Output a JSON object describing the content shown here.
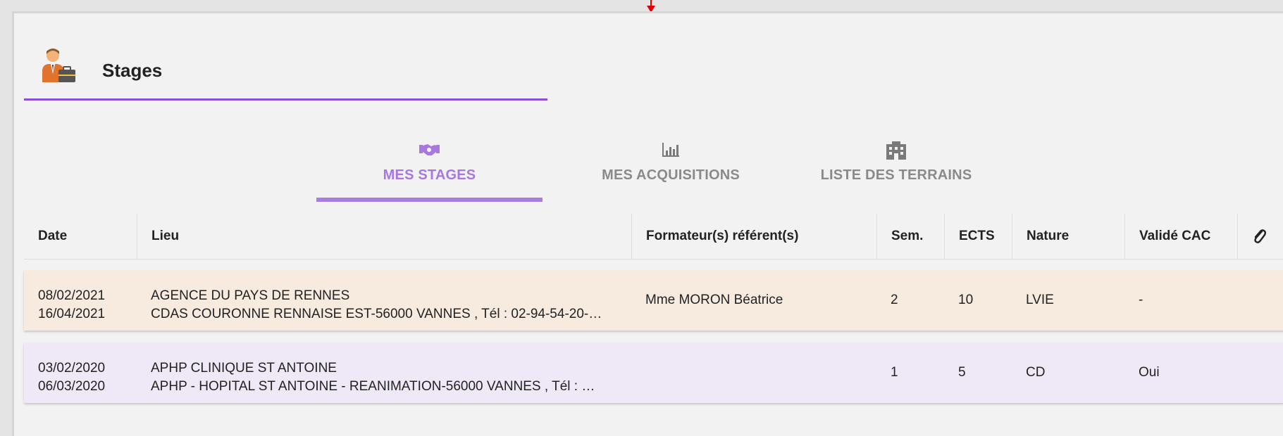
{
  "header": {
    "title": "Stages",
    "icon": "business-person-icon"
  },
  "tabs": [
    {
      "label": "MES STAGES",
      "icon": "handshake-icon",
      "active": true
    },
    {
      "label": "MES ACQUISITIONS",
      "icon": "bar-chart-icon",
      "active": false
    },
    {
      "label": "LISTE DES TERRAINS",
      "icon": "building-icon",
      "active": false
    }
  ],
  "table": {
    "headers": {
      "date": "Date",
      "lieu": "Lieu",
      "formateur": "Formateur(s) référent(s)",
      "sem": "Sem.",
      "ects": "ECTS",
      "nature": "Nature",
      "valide": "Validé CAC",
      "attachment_icon": "paperclip-icon"
    },
    "rows": [
      {
        "date_start": "08/02/2021",
        "date_end": "16/04/2021",
        "lieu_line1": "AGENCE DU PAYS DE RENNES",
        "lieu_line2": "CDAS COURONNE RENNAISE EST-56000 VANNES , Tél : 02-94-54-20-…",
        "formateur": "Mme MORON Béatrice",
        "sem": "2",
        "ects": "10",
        "nature": "LVIE",
        "valide": "-",
        "color": "#f7ebe0"
      },
      {
        "date_start": "03/02/2020",
        "date_end": "06/03/2020",
        "lieu_line1": "APHP CLINIQUE ST ANTOINE",
        "lieu_line2": "APHP - HOPITAL ST ANTOINE - REANIMATION-56000 VANNES , Tél : …",
        "formateur": "",
        "sem": "1",
        "ects": "5",
        "nature": "CD",
        "valide": "Oui",
        "color": "#efe8f6"
      }
    ]
  },
  "colors": {
    "accent": "#8a4fd6",
    "tab_active": "#a878e0",
    "panel_bg": "#f2f2f2"
  }
}
